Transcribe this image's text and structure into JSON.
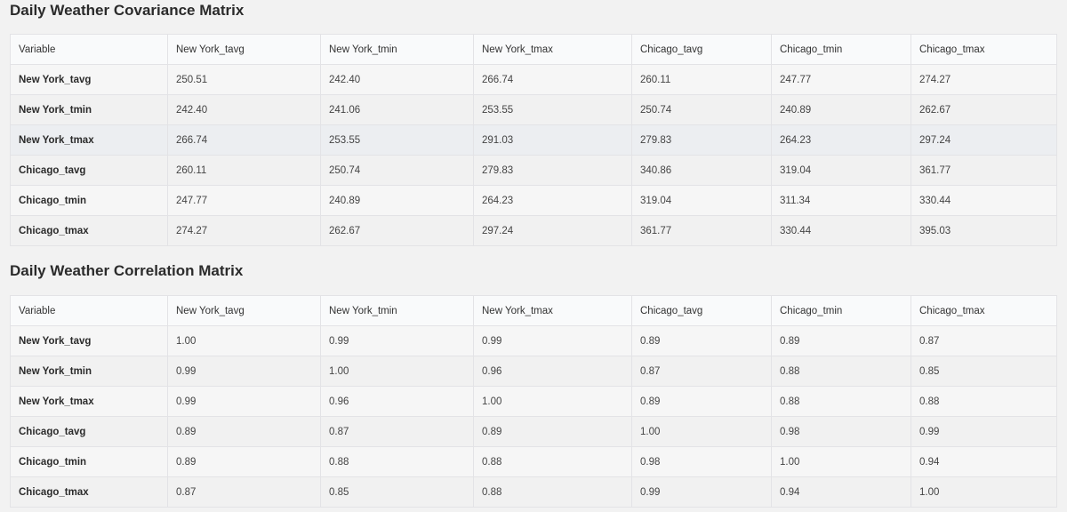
{
  "covariance": {
    "title": "Daily Weather Covariance Matrix",
    "headers": [
      "Variable",
      "New York_tavg",
      "New York_tmin",
      "New York_tmax",
      "Chicago_tavg",
      "Chicago_tmin",
      "Chicago_tmax"
    ],
    "rows": [
      [
        "New York_tavg",
        "250.51",
        "242.40",
        "266.74",
        "260.11",
        "247.77",
        "274.27"
      ],
      [
        "New York_tmin",
        "242.40",
        "241.06",
        "253.55",
        "250.74",
        "240.89",
        "262.67"
      ],
      [
        "New York_tmax",
        "266.74",
        "253.55",
        "291.03",
        "279.83",
        "264.23",
        "297.24"
      ],
      [
        "Chicago_tavg",
        "260.11",
        "250.74",
        "279.83",
        "340.86",
        "319.04",
        "361.77"
      ],
      [
        "Chicago_tmin",
        "247.77",
        "240.89",
        "264.23",
        "319.04",
        "311.34",
        "330.44"
      ],
      [
        "Chicago_tmax",
        "274.27",
        "262.67",
        "297.24",
        "361.77",
        "330.44",
        "395.03"
      ]
    ]
  },
  "correlation": {
    "title": "Daily Weather Correlation Matrix",
    "headers": [
      "Variable",
      "New York_tavg",
      "New York_tmin",
      "New York_tmax",
      "Chicago_tavg",
      "Chicago_tmin",
      "Chicago_tmax"
    ],
    "rows": [
      [
        "New York_tavg",
        "1.00",
        "0.99",
        "0.99",
        "0.89",
        "0.89",
        "0.87"
      ],
      [
        "New York_tmin",
        "0.99",
        "1.00",
        "0.96",
        "0.87",
        "0.88",
        "0.85"
      ],
      [
        "New York_tmax",
        "0.99",
        "0.96",
        "1.00",
        "0.89",
        "0.88",
        "0.88"
      ],
      [
        "Chicago_tavg",
        "0.89",
        "0.87",
        "0.89",
        "1.00",
        "0.98",
        "0.99"
      ],
      [
        "Chicago_tmin",
        "0.89",
        "0.88",
        "0.88",
        "0.98",
        "1.00",
        "0.94"
      ],
      [
        "Chicago_tmax",
        "0.87",
        "0.85",
        "0.88",
        "0.99",
        "0.94",
        "1.00"
      ]
    ]
  }
}
